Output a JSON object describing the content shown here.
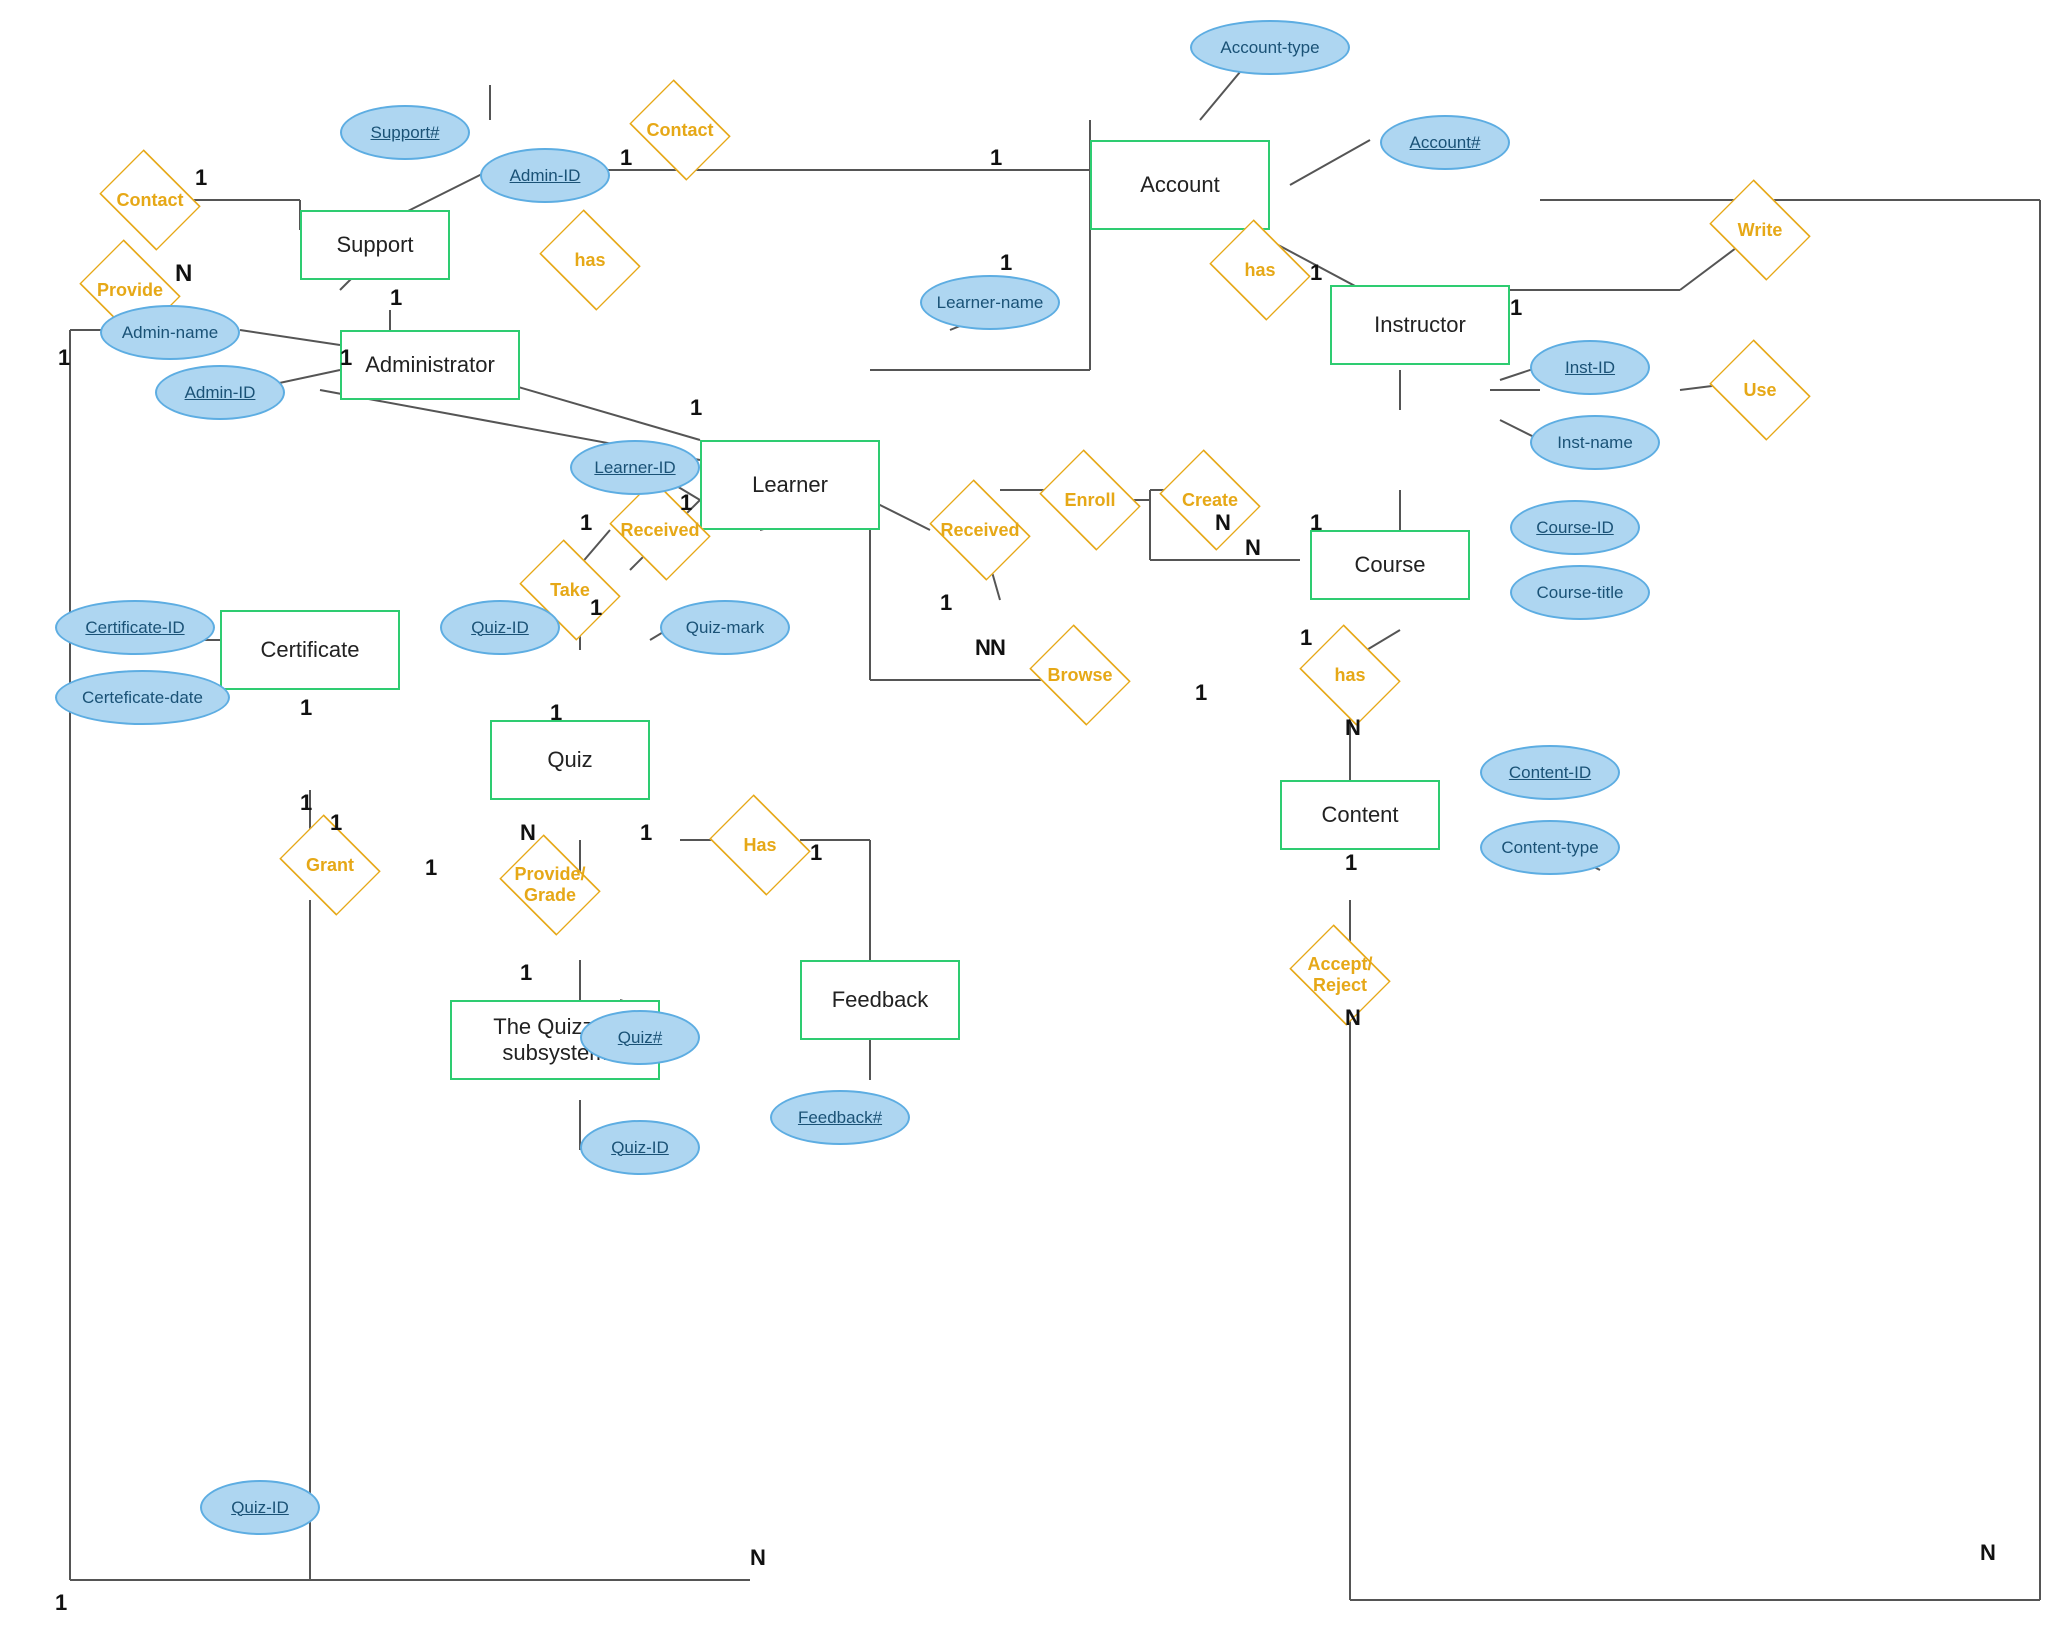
{
  "entities": {
    "account": "Account",
    "support": "Support",
    "administrator": "Administrator",
    "learner": "Learner",
    "instructor": "Instructor",
    "course": "Course",
    "content": "Content",
    "certificate": "Certificate",
    "quiz": "Quiz",
    "quizzes_subsystem": "The Quizzes subsystem",
    "feedback": "Feedback"
  },
  "relationships": {
    "contact_top": "Contact",
    "contact_left": "Contact",
    "provide_left": "Provide",
    "has_account_learner": "has",
    "has_account_instructor": "has",
    "write": "Write",
    "use": "Use",
    "create": "Create",
    "enroll": "Enroll",
    "received_left": "Received",
    "received_right": "Received",
    "take": "Take",
    "browse": "Browse",
    "has_course_content": "has",
    "provide_grade": "Provide/\nGrade",
    "has_quiz_feedback": "Has",
    "grant": "Grant",
    "accept_reject": "Accept/\nReject"
  },
  "attributes": {
    "account_type": "Account-type",
    "account_hash": "Account#",
    "support_hash": "Support#",
    "admin_id": "Admin-ID",
    "learner_name": "Learner-name",
    "admin_name": "Admin-name",
    "learner_id": "Learner-ID",
    "inst_id": "Inst-ID",
    "inst_name": "Inst-name",
    "course_id": "Course-ID",
    "course_title": "Course-title",
    "content_id": "Content-ID",
    "content_type": "Content-type",
    "certificate_id": "Certificate-ID",
    "certificate_date": "Certeficate-date",
    "quiz_id": "Quiz-ID",
    "quiz_mark": "Quiz-mark",
    "quiz_hash": "Quiz#",
    "feedback_hash": "Feedback#"
  }
}
